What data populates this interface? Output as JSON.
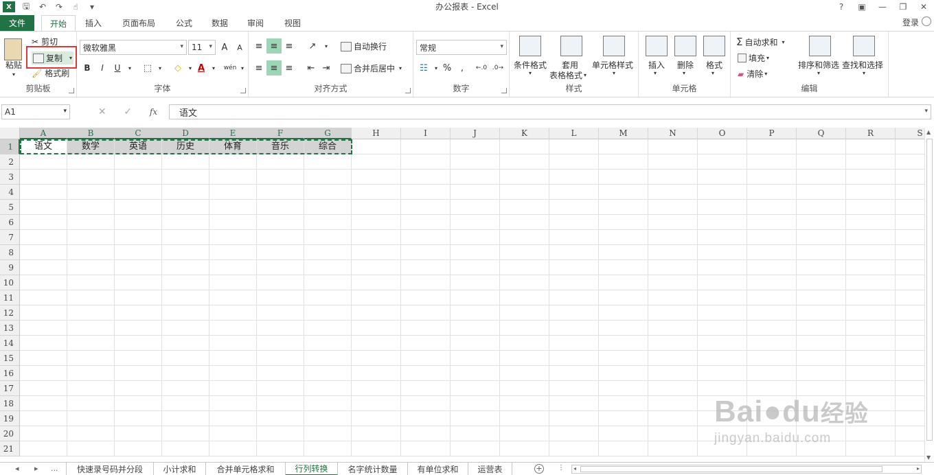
{
  "window": {
    "title": "办公报表 - Excel",
    "qat_icons": [
      "excel-logo",
      "save-icon",
      "undo-icon",
      "redo-icon",
      "touch-mode-icon",
      "customize-qat-icon"
    ],
    "controls": [
      "help-icon",
      "ribbon-display-icon",
      "minimize-icon",
      "restore-icon",
      "close-icon"
    ]
  },
  "tabs": {
    "file": "文件",
    "items": [
      "开始",
      "插入",
      "页面布局",
      "公式",
      "数据",
      "审阅",
      "视图"
    ],
    "active": "开始",
    "login": "登录"
  },
  "ribbon": {
    "clipboard": {
      "label": "剪贴板",
      "paste": "粘贴",
      "cut": "剪切",
      "copy": "复制",
      "format_painter": "格式刷"
    },
    "font": {
      "label": "字体",
      "font_name": "微软雅黑",
      "font_size": "11",
      "bold": "B",
      "italic": "I",
      "underline": "U",
      "increase": "A",
      "decrease": "A",
      "wen": "wén"
    },
    "alignment": {
      "label": "对齐方式",
      "wrap": "自动换行",
      "merge": "合并后居中"
    },
    "number": {
      "label": "数字",
      "format": "常规",
      "percent": "%",
      "comma": ","
    },
    "styles": {
      "label": "样式",
      "conditional": "条件格式",
      "table_1": "套用",
      "table_2": "表格格式",
      "cell_styles": "单元格样式"
    },
    "cells": {
      "label": "单元格",
      "insert": "插入",
      "delete": "删除",
      "format": "格式"
    },
    "editing": {
      "label": "编辑",
      "autosum": "自动求和",
      "fill": "填充",
      "clear": "清除",
      "sort": "排序和筛选",
      "find": "查找和选择"
    }
  },
  "formula_bar": {
    "name_box": "A1",
    "content": "语文",
    "fx": "fx"
  },
  "grid": {
    "columns": [
      "A",
      "B",
      "C",
      "D",
      "E",
      "F",
      "G",
      "H",
      "I",
      "J",
      "K",
      "L",
      "M",
      "N",
      "O",
      "P",
      "Q",
      "R",
      "S"
    ],
    "rows": [
      "1",
      "2",
      "3",
      "4",
      "5",
      "6",
      "7",
      "8",
      "9",
      "10",
      "11",
      "12",
      "13",
      "14",
      "15",
      "16",
      "17",
      "18",
      "19",
      "20",
      "21"
    ],
    "row1": [
      "语文",
      "数学",
      "英语",
      "历史",
      "体育",
      "音乐",
      "综合"
    ],
    "selected_columns": [
      "A",
      "B",
      "C",
      "D",
      "E",
      "F",
      "G"
    ],
    "selected_row": "1"
  },
  "sheets": {
    "more": "...",
    "items": [
      "快速录号码并分段",
      "小计求和",
      "合并单元格求和",
      "行列转换",
      "名字统计数量",
      "有单位求和",
      "运营表"
    ],
    "active": "行列转换"
  },
  "watermark": {
    "main": "Bai",
    "paw": "du",
    "cn": "经验",
    "url": "jingyan.baidu.com"
  },
  "colors": {
    "accent": "#217346",
    "highlight_box": "#d63a3a",
    "selection_fill": "#d4d4d4"
  }
}
